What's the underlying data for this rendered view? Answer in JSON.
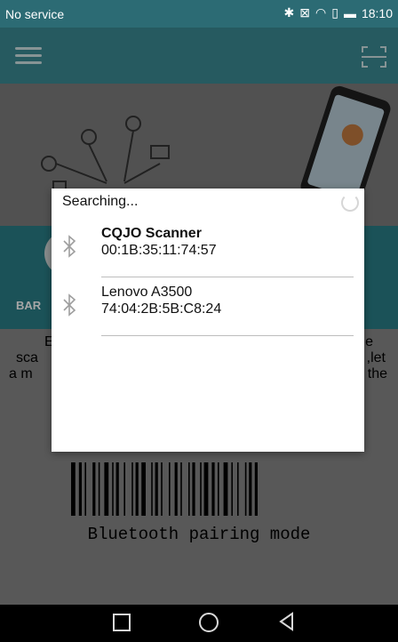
{
  "status_bar": {
    "carrier": "No service",
    "time": "18:10"
  },
  "dialog": {
    "title": "Searching...",
    "devices": [
      {
        "name": "CQJO Scanner",
        "address": "00:1B:35:11:74:57"
      },
      {
        "name": "Lenovo A3500",
        "address": "74:04:2B:5B:C8:24"
      }
    ]
  },
  "background": {
    "band_label": "BAR",
    "left_lines": [
      "E",
      "sca",
      "a m"
    ],
    "right_lines": [
      "e",
      ",let",
      "the"
    ],
    "barcode_caption": "Bluetooth pairing mode"
  },
  "colors": {
    "accent": "#3b8a94",
    "statusbar": "#2c6b74"
  }
}
